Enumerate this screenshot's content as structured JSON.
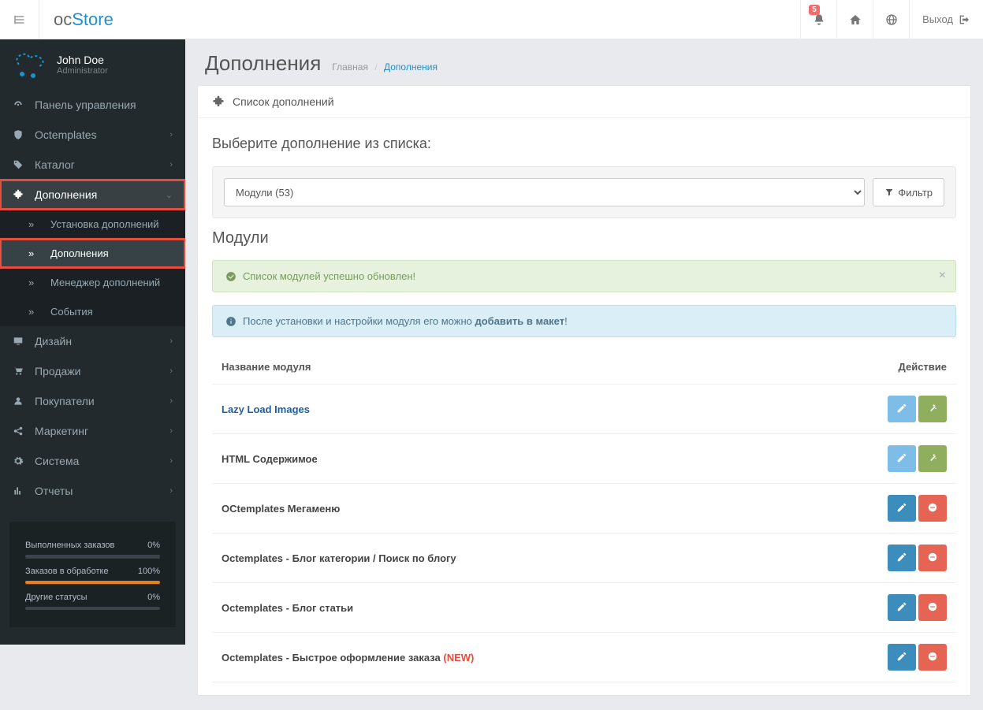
{
  "header": {
    "logo_prefix": "oc",
    "logo_suffix": "Store",
    "notif_count": "5",
    "logout_label": "Выход"
  },
  "user": {
    "name": "John Doe",
    "role": "Administrator"
  },
  "sidebar": {
    "items": [
      {
        "label": "Панель управления"
      },
      {
        "label": "Octemplates"
      },
      {
        "label": "Каталог"
      },
      {
        "label": "Дополнения"
      },
      {
        "label": "Дизайн"
      },
      {
        "label": "Продажи"
      },
      {
        "label": "Покупатели"
      },
      {
        "label": "Маркетинг"
      },
      {
        "label": "Система"
      },
      {
        "label": "Отчеты"
      }
    ],
    "sub": [
      {
        "label": "Установка дополнений"
      },
      {
        "label": "Дополнения"
      },
      {
        "label": "Менеджер дополнений"
      },
      {
        "label": "События"
      }
    ]
  },
  "stats": [
    {
      "label": "Выполненных заказов",
      "value": "0%",
      "fill": 0
    },
    {
      "label": "Заказов в обработке",
      "value": "100%",
      "fill": 100
    },
    {
      "label": "Другие статусы",
      "value": "0%",
      "fill": 0
    }
  ],
  "page": {
    "title": "Дополнения",
    "crumb_home": "Главная",
    "crumb_current": "Дополнения"
  },
  "panel": {
    "heading": "Список дополнений",
    "subheading": "Выберите дополнение из списка:",
    "select_value": "Модули (53)",
    "filter_label": "Фильтр",
    "section_title": "Модули"
  },
  "alerts": {
    "success": "Список модулей успешно обновлен!",
    "info_prefix": "После установки и настройки модуля его можно ",
    "info_bold": "добавить в макет",
    "info_suffix": "!"
  },
  "table": {
    "col_name": "Название модуля",
    "col_action": "Действие",
    "rows": [
      {
        "name": "Lazy Load Images",
        "link": true,
        "actions": "lightblue_green_highlight"
      },
      {
        "name": "HTML Содержимое",
        "link": false,
        "actions": "lightblue_green"
      },
      {
        "name": "OCtemplates Мегаменю",
        "link": false,
        "actions": "blue_red"
      },
      {
        "name": "Octemplates - Блог категории / Поиск по блогу",
        "link": false,
        "actions": "blue_red"
      },
      {
        "name": "Octemplates - Блог статьи",
        "link": false,
        "actions": "blue_red"
      },
      {
        "name": "Octemplates - Быстрое оформление заказа ",
        "link": false,
        "new": "(NEW)",
        "actions": "blue_red"
      }
    ]
  }
}
